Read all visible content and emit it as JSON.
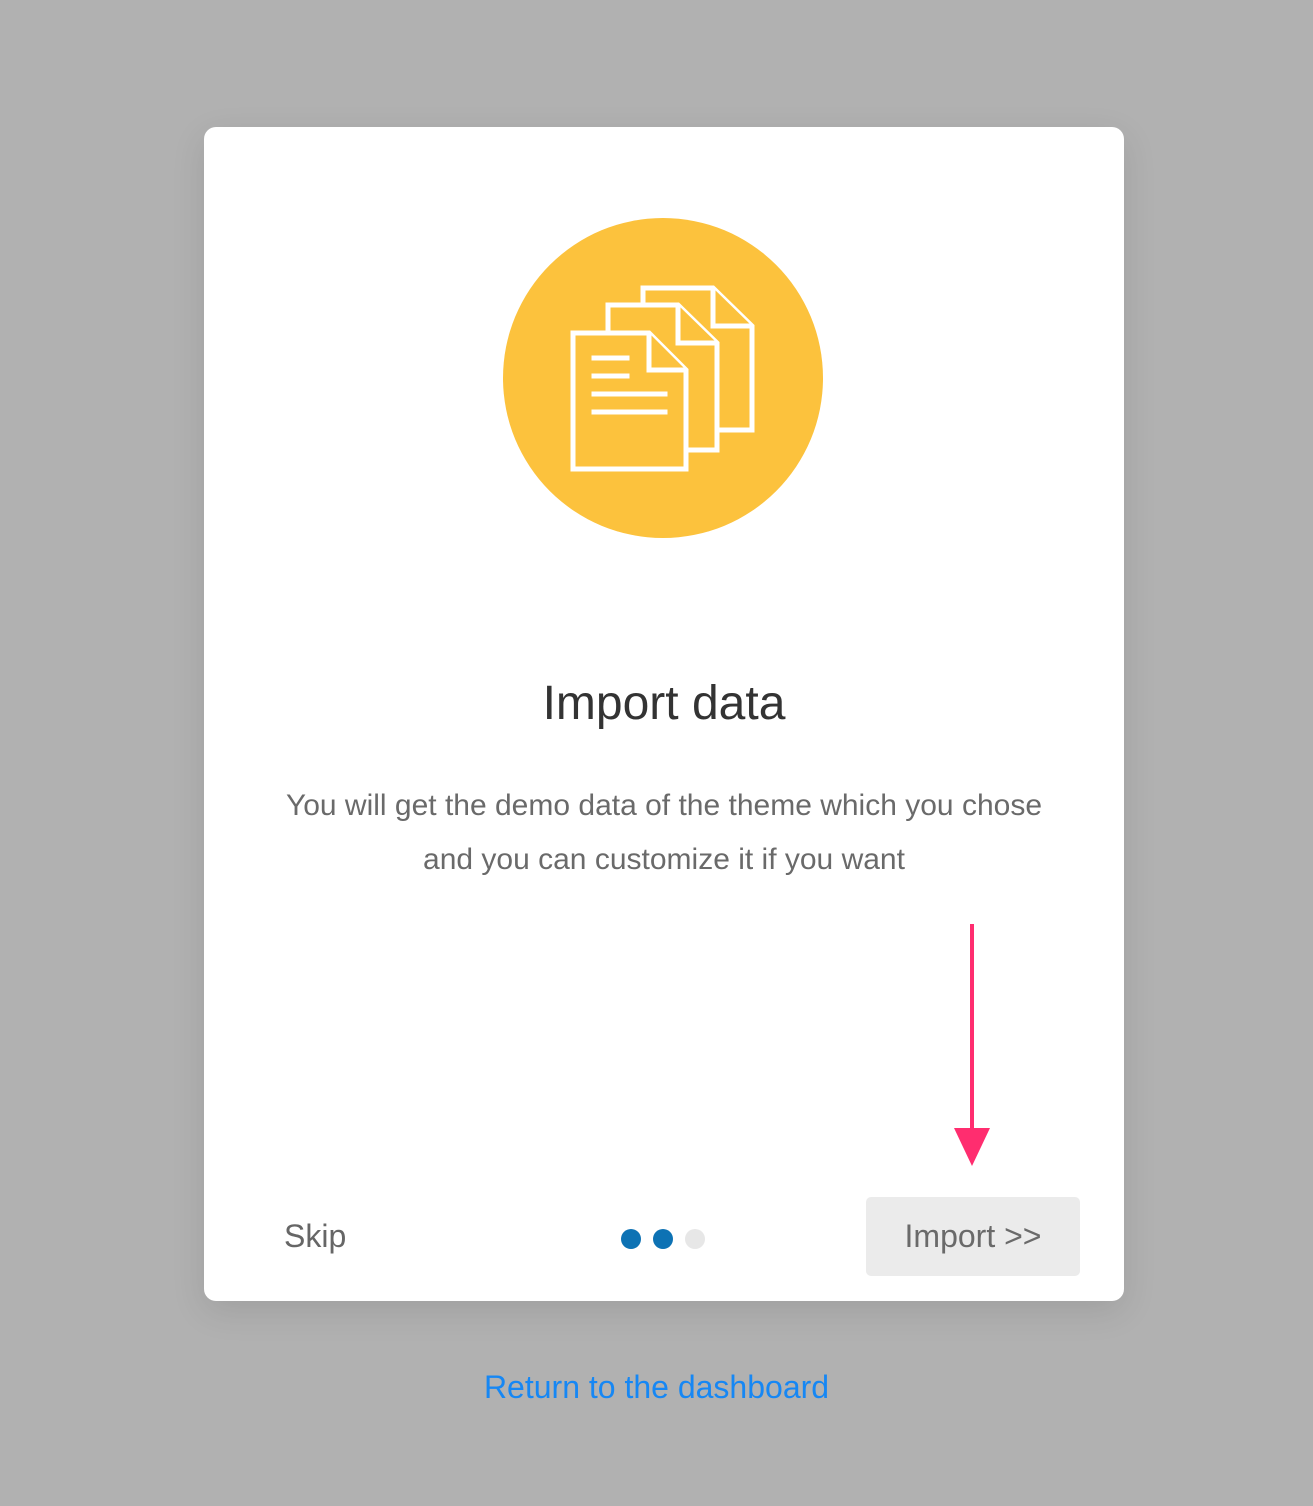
{
  "card": {
    "title": "Import data",
    "description": "You will get the demo data of the theme which you chose and you can customize it if you want",
    "hero_icon": "documents-icon",
    "accent_color": "#fcc23d"
  },
  "footer": {
    "skip_label": "Skip",
    "import_label": "Import >>",
    "progress": {
      "current_step": 2,
      "total_steps": 3,
      "active_color": "#0d72b4",
      "inactive_color": "#e7e7e7"
    }
  },
  "annotation": {
    "arrow_color": "#ff2d6f"
  },
  "dashboard_link": "Return to the dashboard"
}
